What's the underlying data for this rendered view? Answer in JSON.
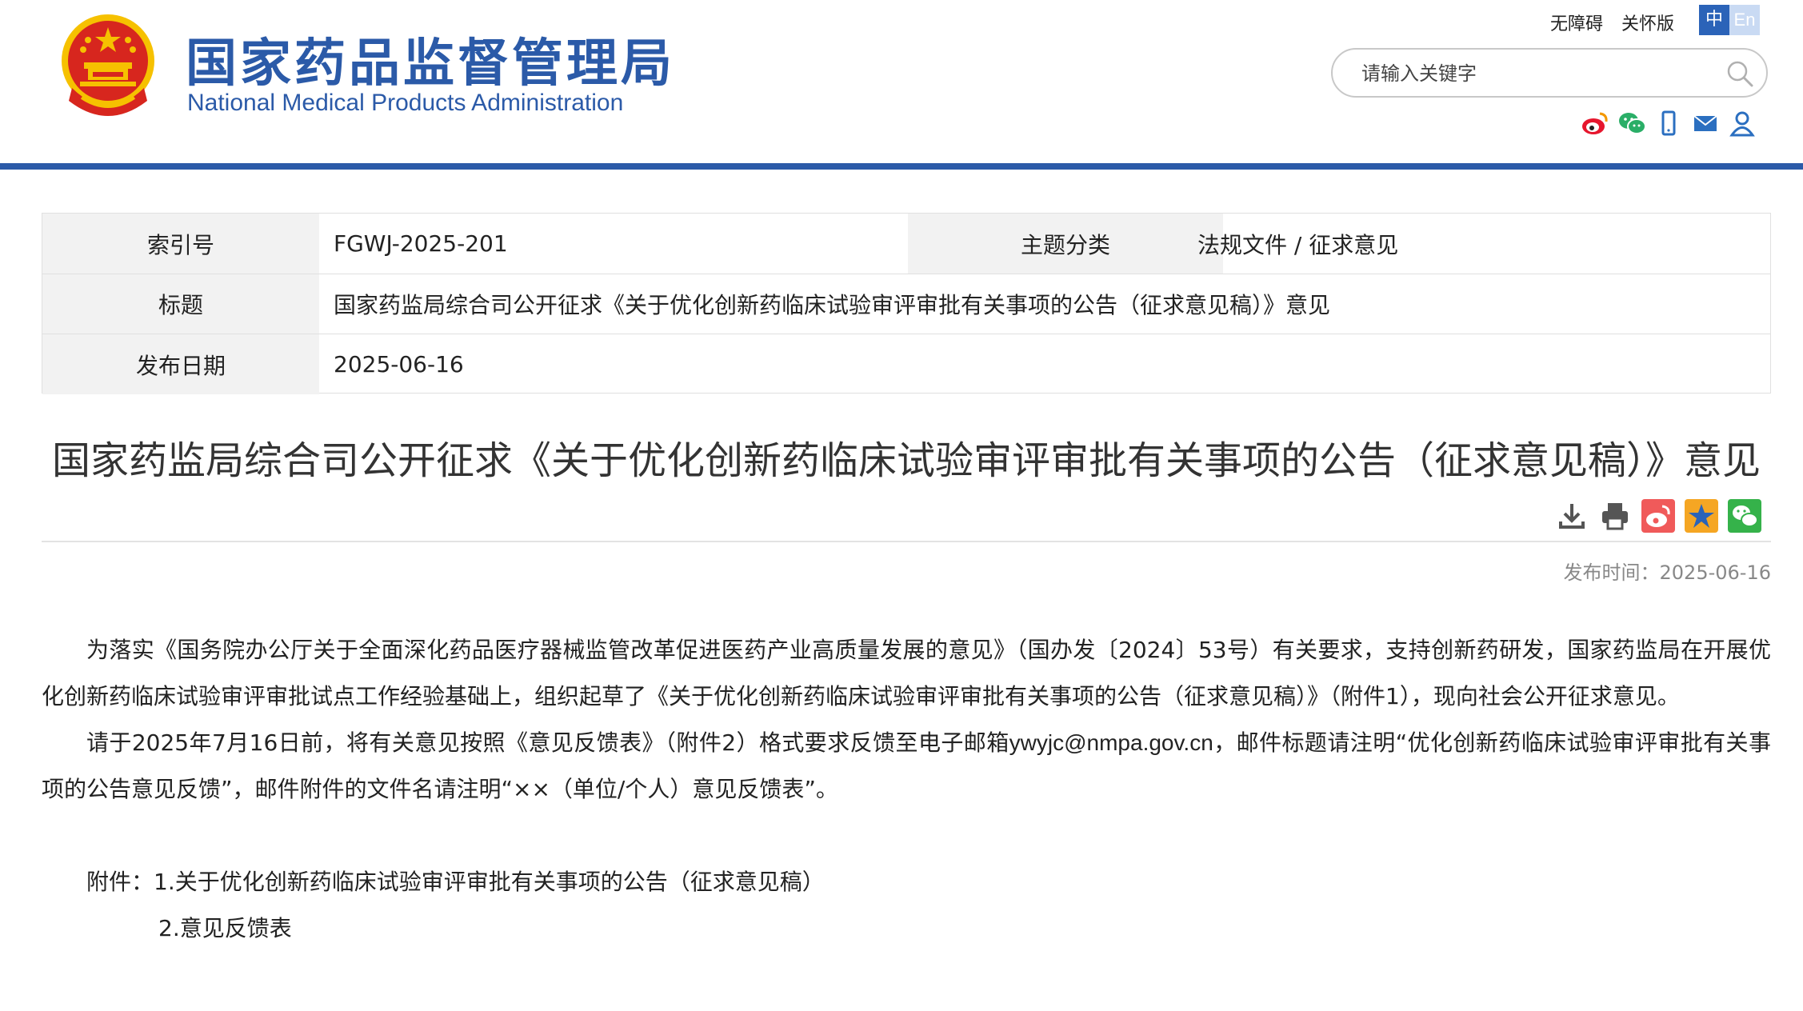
{
  "header": {
    "brand_cn": "国家药品监督管理局",
    "brand_en": "National Medical Products Administration",
    "accessibility_link": "无障碍",
    "elder_link": "关怀版",
    "lang_zh": "中",
    "lang_en": "En",
    "search_placeholder": "请输入关键字",
    "social_icons": [
      "weibo-icon",
      "wechat-icon",
      "mobile-icon",
      "mail-icon",
      "user-icon"
    ],
    "colors": {
      "brand_blue": "#2b5aa8",
      "emblem_red": "#d7261e",
      "emblem_gold": "#f6c100"
    }
  },
  "info_table": {
    "index_label": "索引号",
    "index_value": "FGWJ-2025-201",
    "category_label": "主题分类",
    "category_value": "法规文件 / 征求意见",
    "title_label": "标题",
    "title_value": "国家药监局综合司公开征求《关于优化创新药临床试验审评审批有关事项的公告（征求意见稿）》意见",
    "date_label": "发布日期",
    "date_value": "2025-06-16"
  },
  "article": {
    "title": "国家药监局综合司公开征求《关于优化创新药临床试验审评审批有关事项的公告（征求意见稿）》意见",
    "tool_icons": [
      "download-icon",
      "print-icon",
      "weibo-share-icon",
      "favorite-icon",
      "wechat-share-icon"
    ],
    "pub_time": "发布时间：2025-06-16",
    "para1": "为落实《国务院办公厅关于全面深化药品医疗器械监管改革促进医药产业高质量发展的意见》（国办发〔2024〕53号）有关要求，支持创新药研发，国家药监局在开展优化创新药临床试验审评审批试点工作经验基础上，组织起草了《关于优化创新药临床试验审评审批有关事项的公告（征求意见稿）》（附件1），现向社会公开征求意见。",
    "para2_a": "请于2025年7月16日前，将有关意见按照《意见反馈表》（附件2）格式要求反馈至电子邮箱",
    "para2_email": "ywyjc@nmpa.gov.cn",
    "para2_b": "，邮件标题请注明“优化创新药临床试验审评审批有关事项的公告意见反馈”，邮件附件的文件名请注明“××（单位/个人）意见反馈表”。",
    "attachment_1": "附件：1.关于优化创新药临床试验审评审批有关事项的公告（征求意见稿）",
    "attachment_2": "2.意见反馈表"
  }
}
